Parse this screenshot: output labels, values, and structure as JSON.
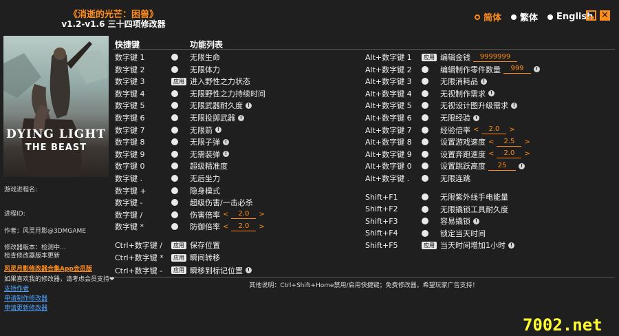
{
  "app": {
    "title_line1": "《消逝的光芒：困兽》",
    "title_line2": "v1.2-v1.6 三十四项修改器"
  },
  "languages": [
    {
      "label": "简体",
      "active": true
    },
    {
      "label": "繁体",
      "active": false
    },
    {
      "label": "English",
      "active": false
    }
  ],
  "cover": {
    "logo_line1": "DYING LIGHT",
    "logo_line2": "THE BEAST"
  },
  "left_info": {
    "process_name": "游戏进程名:",
    "process_id": "进程ID:",
    "author": "作者：风灵月影@3DMGAME",
    "version_line1": "修改器版本：检测中...",
    "version_line2": "检查修改器版本更新",
    "app_link": "风灵月影修改器合集App会员版",
    "support_text": "如果喜欢我的修改器，请考虑会员支持❤",
    "link1": "支持作者",
    "link2": "申请制作修改器",
    "link3": "申请更新修改器"
  },
  "headers": {
    "hotkey": "快捷键",
    "features": "功能列表"
  },
  "button_label": "应用",
  "left_rows": [
    {
      "key": "数字键 1",
      "name": "无限生命",
      "ctl": "dot",
      "warn": false
    },
    {
      "key": "数字键 2",
      "name": "无限体力",
      "ctl": "dot",
      "warn": false
    },
    {
      "key": "数字键 3",
      "name": "进入野性之力状态",
      "ctl": "btn",
      "warn": false
    },
    {
      "key": "数字键 4",
      "name": "无限野性之力持续时间",
      "ctl": "dot",
      "warn": false
    },
    {
      "key": "数字键 5",
      "name": "无限武器耐久度",
      "ctl": "dot",
      "warn": true
    },
    {
      "key": "数字键 6",
      "name": "无限投掷武器",
      "ctl": "dot",
      "warn": true
    },
    {
      "key": "数字键 7",
      "name": "无限箭",
      "ctl": "dot",
      "warn": true
    },
    {
      "key": "数字键 8",
      "name": "无限子弹",
      "ctl": "dot",
      "warn": true
    },
    {
      "key": "数字键 9",
      "name": "无需装弹",
      "ctl": "dot",
      "warn": true
    },
    {
      "key": "数字键 0",
      "name": "超级精准度",
      "ctl": "dot",
      "warn": false
    },
    {
      "key": "数字键 .",
      "name": "无后坐力",
      "ctl": "dot",
      "warn": false
    },
    {
      "key": "数字键 +",
      "name": "隐身模式",
      "ctl": "dot",
      "warn": false
    },
    {
      "key": "数字键 -",
      "name": "超级伤害/一击必杀",
      "ctl": "dot",
      "warn": false
    },
    {
      "key": "数字键 /",
      "name": "伤害倍率",
      "ctl": "dot",
      "warn": false,
      "value": "2.0",
      "arrows": true
    },
    {
      "key": "数字键 *",
      "name": "防御倍率",
      "ctl": "dot",
      "warn": false,
      "value": "2.0",
      "arrows": true
    }
  ],
  "left_rows2": [
    {
      "key": "Ctrl+数字键 /",
      "name": "保存位置",
      "ctl": "btn",
      "warn": false
    },
    {
      "key": "Ctrl+数字键 *",
      "name": "瞬间转移",
      "ctl": "btn",
      "warn": false
    },
    {
      "key": "Ctrl+数字键 -",
      "name": "瞬移到标记位置",
      "ctl": "btn",
      "warn": true
    }
  ],
  "right_rows": [
    {
      "key": "Alt+数字键 1",
      "name": "编辑金钱",
      "ctl": "btn",
      "warn": false,
      "value": "9999999",
      "arrows": false
    },
    {
      "key": "Alt+数字键 2",
      "name": "编辑制作零件数量",
      "ctl": "dot",
      "warn": true,
      "value": "999",
      "arrows": false
    },
    {
      "key": "Alt+数字键 3",
      "name": "无限消耗品",
      "ctl": "dot",
      "warn": true
    },
    {
      "key": "Alt+数字键 4",
      "name": "无视制作需求",
      "ctl": "dot",
      "warn": true
    },
    {
      "key": "Alt+数字键 5",
      "name": "无视设计图升级需求",
      "ctl": "dot",
      "warn": true
    },
    {
      "key": "Alt+数字键 6",
      "name": "无限经验",
      "ctl": "dot",
      "warn": true
    },
    {
      "key": "Alt+数字键 7",
      "name": "经验倍率",
      "ctl": "dot",
      "warn": false,
      "value": "2.0",
      "arrows": true
    },
    {
      "key": "Alt+数字键 8",
      "name": "设置游戏速度",
      "ctl": "dot",
      "warn": false,
      "value": "2.5",
      "arrows": true
    },
    {
      "key": "Alt+数字键 9",
      "name": "设置奔跑速度",
      "ctl": "dot",
      "warn": false,
      "value": "2.0",
      "arrows": true
    },
    {
      "key": "Alt+数字键 0",
      "name": "设置跳跃高度",
      "ctl": "dot",
      "warn": true,
      "value": "25",
      "arrows": false
    },
    {
      "key": "Alt+数字键 .",
      "name": "无限连跳",
      "ctl": "dot",
      "warn": false
    }
  ],
  "right_rows2": [
    {
      "key": "Shift+F1",
      "name": "无限紫外线手电能量",
      "ctl": "dot",
      "warn": false
    },
    {
      "key": "Shift+F2",
      "name": "无限撬锁工具耐久度",
      "ctl": "dot",
      "warn": false
    },
    {
      "key": "Shift+F3",
      "name": "容易撬锁",
      "ctl": "dot",
      "warn": true
    },
    {
      "key": "Shift+F4",
      "name": "锁定当天时间",
      "ctl": "dot",
      "warn": false
    },
    {
      "key": "Shift+F5",
      "name": "当天时间增加1小时",
      "ctl": "btn",
      "warn": true
    }
  ],
  "footer": "其他说明：Ctrl+Shift+Home禁用/启用快捷键；免费修改器，希望玩家广告支持！",
  "watermark": "7002.net"
}
